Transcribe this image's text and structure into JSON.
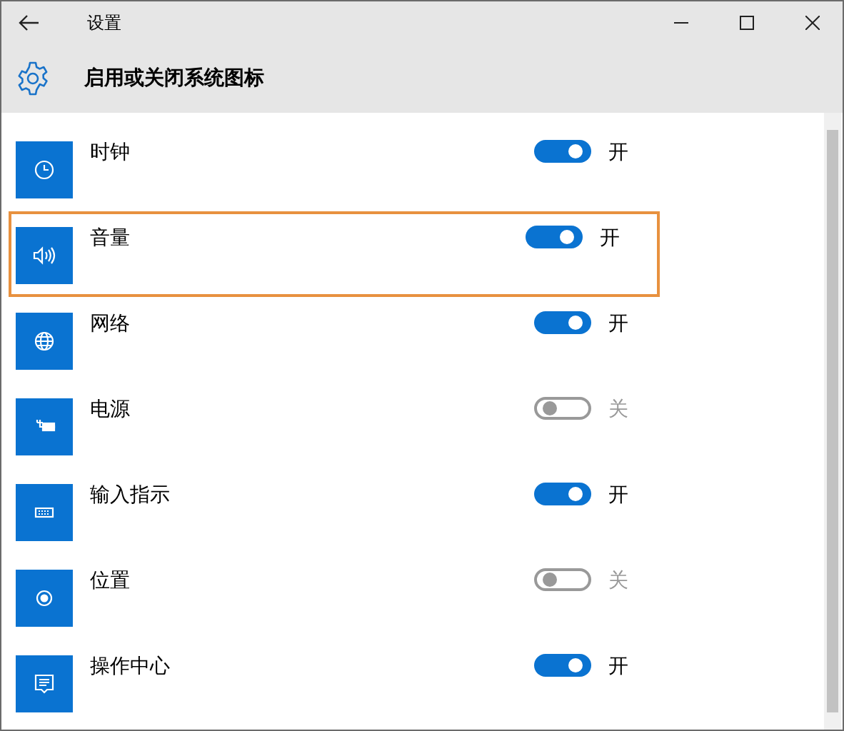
{
  "window": {
    "title": "设置"
  },
  "header": {
    "title": "启用或关闭系统图标"
  },
  "items": [
    {
      "label": "时钟",
      "on": true,
      "state_text": "开",
      "highlighted": false
    },
    {
      "label": "音量",
      "on": true,
      "state_text": "开",
      "highlighted": true
    },
    {
      "label": "网络",
      "on": true,
      "state_text": "开",
      "highlighted": false
    },
    {
      "label": "电源",
      "on": false,
      "state_text": "关",
      "highlighted": false
    },
    {
      "label": "输入指示",
      "on": true,
      "state_text": "开",
      "highlighted": false
    },
    {
      "label": "位置",
      "on": false,
      "state_text": "关",
      "highlighted": false
    },
    {
      "label": "操作中心",
      "on": true,
      "state_text": "开",
      "highlighted": false
    }
  ]
}
